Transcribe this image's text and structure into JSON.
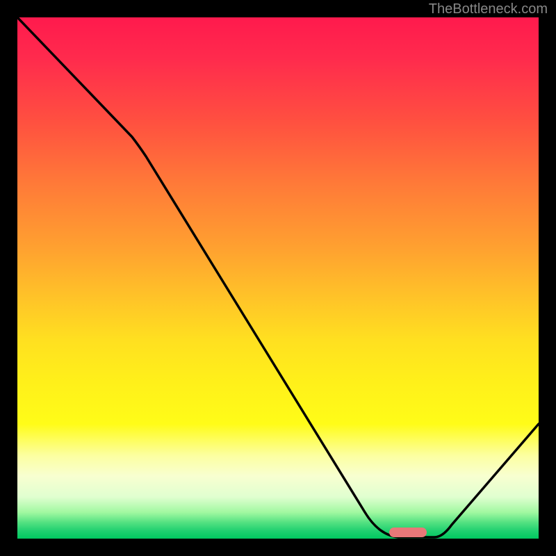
{
  "watermark": "TheBottleneck.com",
  "chart_data": {
    "type": "line",
    "title": "",
    "xlabel": "",
    "ylabel": "",
    "x_range": [
      0,
      100
    ],
    "y_range": [
      0,
      100
    ],
    "series": [
      {
        "name": "curve",
        "points_xy": [
          [
            0,
            100
          ],
          [
            22,
            77
          ],
          [
            67,
            5
          ],
          [
            73,
            0
          ],
          [
            80,
            0
          ],
          [
            100,
            22
          ]
        ]
      }
    ],
    "optimal_marker": {
      "x": 75,
      "y": 0,
      "color": "#e87878"
    },
    "gradient": {
      "top": "#ff1a4d",
      "mid": "#ffe020",
      "bottom": "#00c860"
    }
  }
}
